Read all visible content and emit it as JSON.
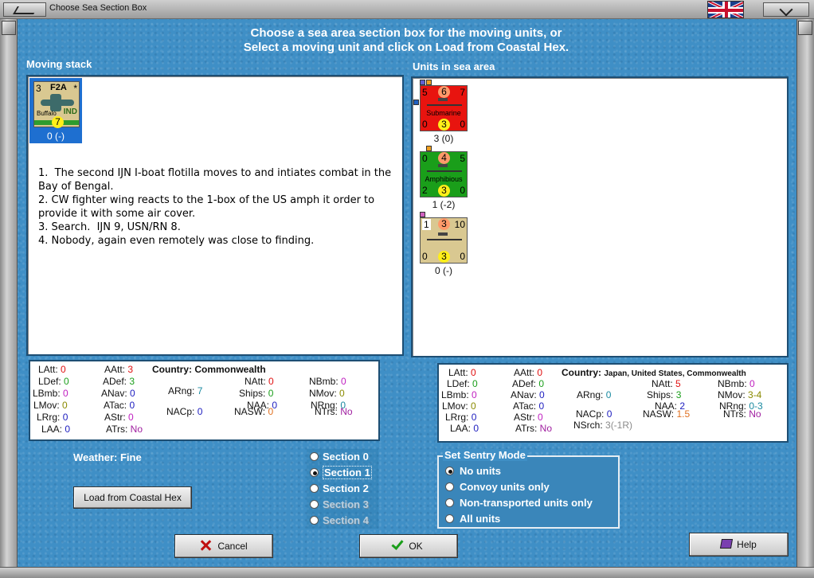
{
  "window": {
    "title": "Choose Sea Section Box"
  },
  "instructions": {
    "line1": "Choose a sea area section box for the moving units, or",
    "line2": "Select a moving unit and click on Load from Coastal Hex."
  },
  "moving_stack": {
    "label": "Moving stack",
    "unit": {
      "top_left": "3",
      "type": "F2A",
      "top_right": "*",
      "name": "Buffalo",
      "nation": "IND",
      "bottom_center": "7",
      "caption": "0 (-)"
    },
    "notes": "1.  The second IJN I-boat flotilla moves to and intiates combat in the Bay of Bengal.\n2. CW fighter wing reacts to the 1-box of the US amph it order to provide it with some air cover.\n3. Search.  IJN 9, USN/RN 8.\n4. Nobody, again even remotely was close to finding."
  },
  "sea_area": {
    "label": "Units in sea area",
    "units": [
      {
        "name": "Submarine",
        "top_left": "5",
        "top_center": "6",
        "top_right": "7",
        "bottom_left": "0",
        "bottom_center": "3",
        "bottom_right": "0",
        "caption": "3 (0)",
        "color": "#e8140f"
      },
      {
        "name": "Amphibious",
        "top_left": "0",
        "top_center": "4",
        "top_right": "5",
        "bottom_left": "2",
        "bottom_center": "3",
        "bottom_right": "0",
        "caption": "1 (-2)",
        "color": "#1a9e1a"
      },
      {
        "name": "",
        "top_left": "1",
        "top_center": "3",
        "top_right": "10",
        "bottom_left": "0",
        "bottom_center": "3",
        "bottom_right": "0",
        "caption": "0 (-)",
        "color": "#d9c891"
      }
    ]
  },
  "stats_left": {
    "country_label": "Country:",
    "country": "Commonwealth",
    "LAtt": "0",
    "LDef": "0",
    "LBmb": "0",
    "LMov": "0",
    "LRrg": "0",
    "LAA": "0",
    "AAtt": "3",
    "ADef": "3",
    "ANav": "0",
    "ATac": "0",
    "AStr": "0",
    "ATrs": "No",
    "ARng": "7",
    "NACp": "0",
    "NAtt": "0",
    "Ships": "0",
    "NAA": "0",
    "NASW": "0",
    "NBmb": "0",
    "NMov": "0",
    "NRng": "0",
    "NTrs": "No"
  },
  "stats_right": {
    "country_label": "Country:",
    "country": "Japan, United States, Commonwealth",
    "LAtt": "0",
    "LDef": "0",
    "LBmb": "0",
    "LMov": "0",
    "LRrg": "0",
    "LAA": "0",
    "AAtt": "0",
    "ADef": "0",
    "ANav": "0",
    "ATac": "0",
    "AStr": "0",
    "ATrs": "No",
    "ARng": "0",
    "NACp": "0",
    "NSrch": "3(-1R)",
    "NAtt": "5",
    "Ships": "3",
    "NAA": "2",
    "NASW": "1.5",
    "NBmb": "0",
    "NMov": "3-4",
    "NRng": "0-3",
    "NTrs": "No"
  },
  "weather": "Weather: Fine",
  "buttons": {
    "load": "Load from Coastal Hex",
    "cancel": "Cancel",
    "ok": "OK",
    "help": "Help"
  },
  "sections": [
    "Section 0",
    "Section 1",
    "Section 2",
    "Section 3",
    "Section 4"
  ],
  "sentry": {
    "legend": "Set Sentry Mode",
    "options": [
      "No units",
      "Convoy units only",
      "Non-transported units only",
      "All units"
    ]
  }
}
